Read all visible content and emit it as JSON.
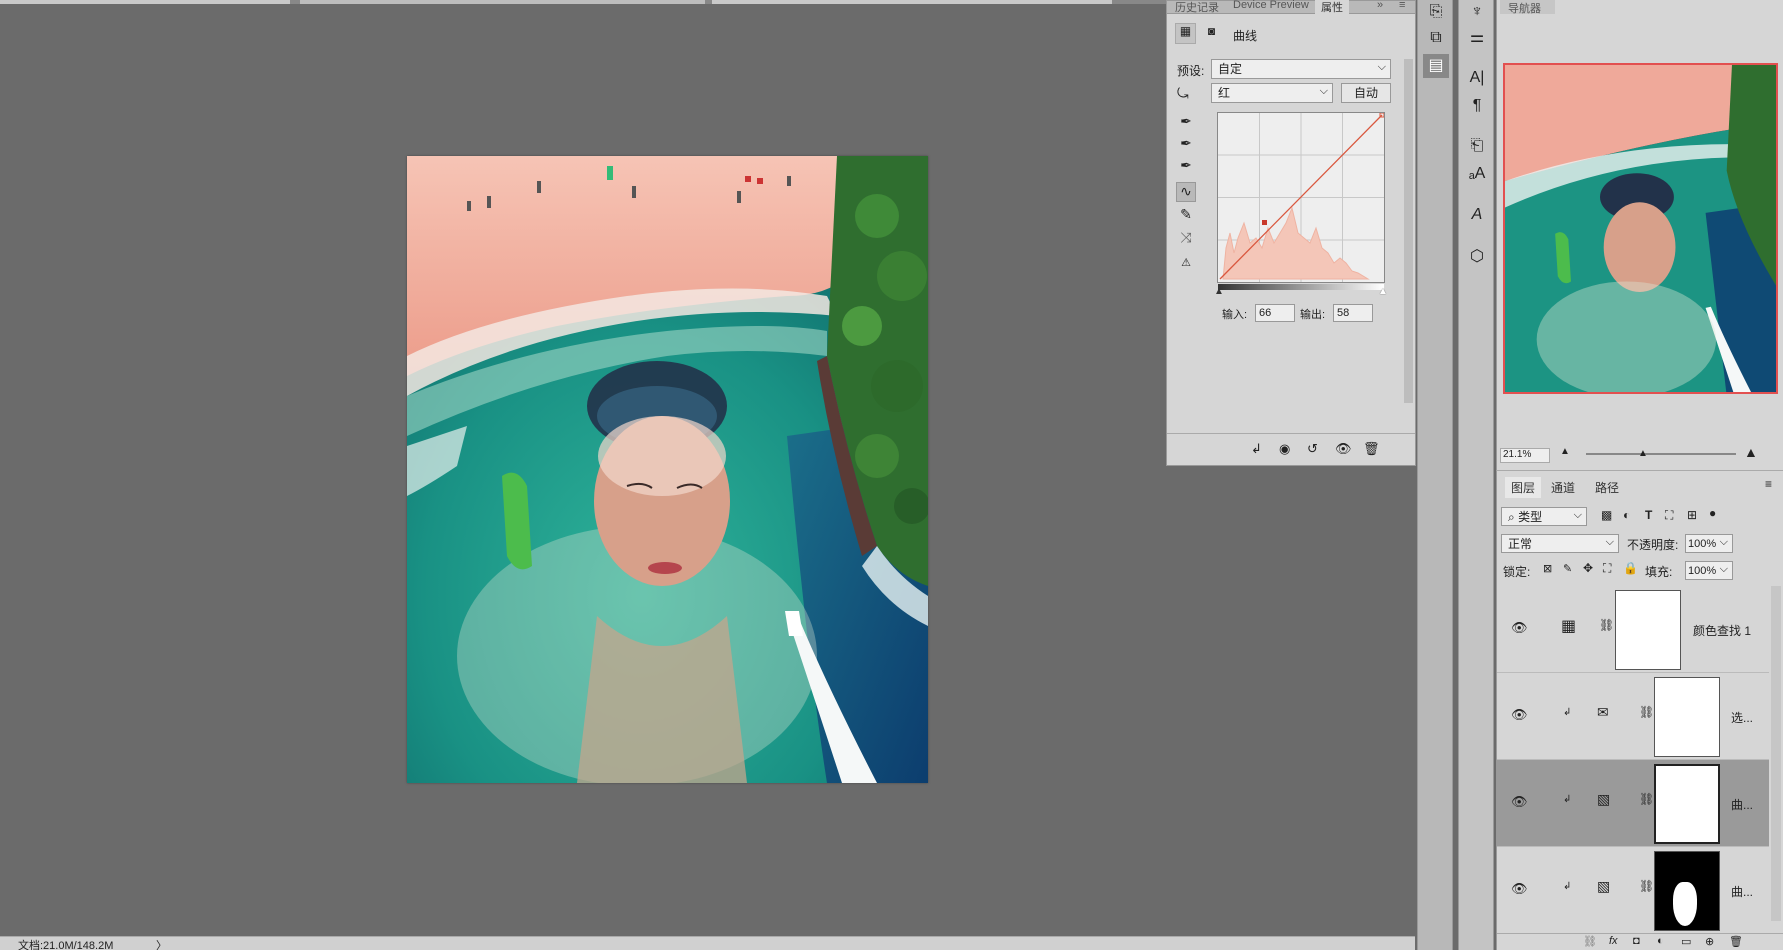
{
  "status": {
    "doc": "文档:21.0M/148.2M",
    "arrow": "〉"
  },
  "props": {
    "tabs": [
      "历史记录",
      "Device Preview",
      "属性"
    ],
    "tab_menu": "»",
    "title": "曲线",
    "preset_label": "预设:",
    "preset_value": "自定",
    "channel_value": "红",
    "auto_button": "自动",
    "input_label": "输入:",
    "input_value": "66",
    "output_label": "输出:",
    "output_value": "58",
    "curve_point": {
      "input": 66,
      "output": 58
    }
  },
  "navigator": {
    "tab": "导航器",
    "zoom": "21.1%"
  },
  "layers": {
    "tabs": [
      "图层",
      "通道",
      "路径"
    ],
    "filter_kind": "类型",
    "blend_mode": "正常",
    "opacity_label": "不透明度:",
    "opacity_value": "100%",
    "lock_label": "锁定:",
    "fill_label": "填充:",
    "fill_value": "100%",
    "items": [
      {
        "name": "颜色查找 1"
      },
      {
        "name": "选..."
      },
      {
        "name": "曲..."
      },
      {
        "name": "曲..."
      }
    ]
  },
  "icons": {
    "strip1": [
      "history-icon",
      "device-icon",
      "properties-icon"
    ],
    "strip2": [
      "brush-presets-icon",
      "adjust-icon",
      "character-icon",
      "paragraph-icon",
      "char-style-icon",
      "para-style-icon",
      "glyphs-icon",
      "3d-icon"
    ]
  },
  "colors": {
    "accent_red": "#e25050",
    "sand": "#f0a595",
    "sea": "#1e9b86",
    "forest": "#2e6b2e"
  }
}
